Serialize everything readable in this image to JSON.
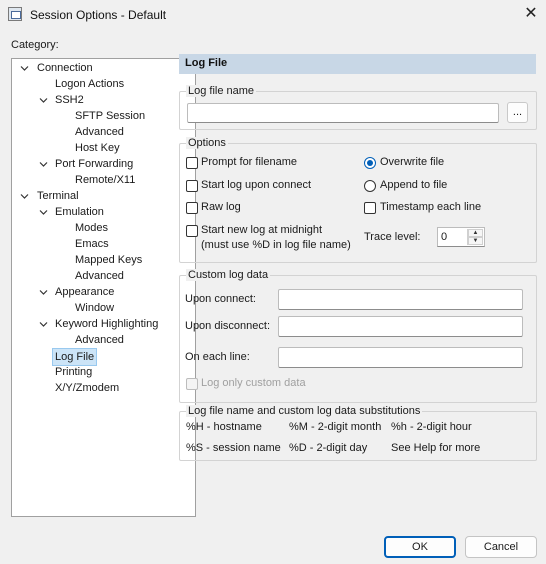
{
  "window": {
    "title": "Session Options - Default",
    "close_icon": "close-icon"
  },
  "category_label": "Category:",
  "tree": {
    "connection": "Connection",
    "logon_actions": "Logon Actions",
    "ssh2": "SSH2",
    "sftp_session": "SFTP Session",
    "advanced_ssh2": "Advanced",
    "host_key": "Host Key",
    "port_forwarding": "Port Forwarding",
    "remote_x11": "Remote/X11",
    "terminal": "Terminal",
    "emulation": "Emulation",
    "modes": "Modes",
    "emacs": "Emacs",
    "mapped_keys": "Mapped Keys",
    "advanced_emulation": "Advanced",
    "appearance": "Appearance",
    "window": "Window",
    "keyword_highlighting": "Keyword Highlighting",
    "advanced_keyword": "Advanced",
    "log_file": "Log File",
    "printing": "Printing",
    "xyzmodem": "X/Y/Zmodem",
    "selected": "Log File"
  },
  "panel": {
    "header": "Log File",
    "log_file_name": {
      "group_label": "Log file name",
      "value": "",
      "browse_label": "..."
    },
    "options": {
      "group_label": "Options",
      "prompt_for_filename": {
        "label": "Prompt for filename",
        "checked": false
      },
      "start_log_upon_connect": {
        "label": "Start log upon connect",
        "checked": false
      },
      "raw_log": {
        "label": "Raw log",
        "checked": false
      },
      "start_new_log": {
        "label_line1": "Start new log at midnight",
        "label_line2": "(must use %D in log file name)",
        "checked": false
      },
      "overwrite_file": {
        "label": "Overwrite file",
        "selected": true
      },
      "append_to_file": {
        "label": "Append to file",
        "selected": false
      },
      "timestamp_each_line": {
        "label": "Timestamp each line",
        "checked": false
      },
      "trace_level": {
        "label": "Trace level:",
        "value": "0"
      }
    },
    "custom_log_data": {
      "group_label": "Custom log data",
      "upon_connect": {
        "label": "Upon connect:",
        "value": ""
      },
      "upon_disconnect": {
        "label": "Upon disconnect:",
        "value": ""
      },
      "on_each_line": {
        "label": "On each line:",
        "value": ""
      },
      "log_only_custom": {
        "label": "Log only custom data",
        "checked": false,
        "enabled": false
      }
    },
    "substitutions": {
      "group_label": "Log file name and custom log data substitutions",
      "row1": [
        "%H - hostname",
        "%M - 2-digit month",
        "%h - 2-digit hour"
      ],
      "row2": [
        "%S - session name",
        "%D - 2-digit day",
        "See Help for more"
      ]
    }
  },
  "buttons": {
    "ok": "OK",
    "cancel": "Cancel"
  },
  "colors": {
    "accent": "#005fb8",
    "header_bg": "#c8d7e6",
    "selection_bg": "#cce4f7"
  }
}
